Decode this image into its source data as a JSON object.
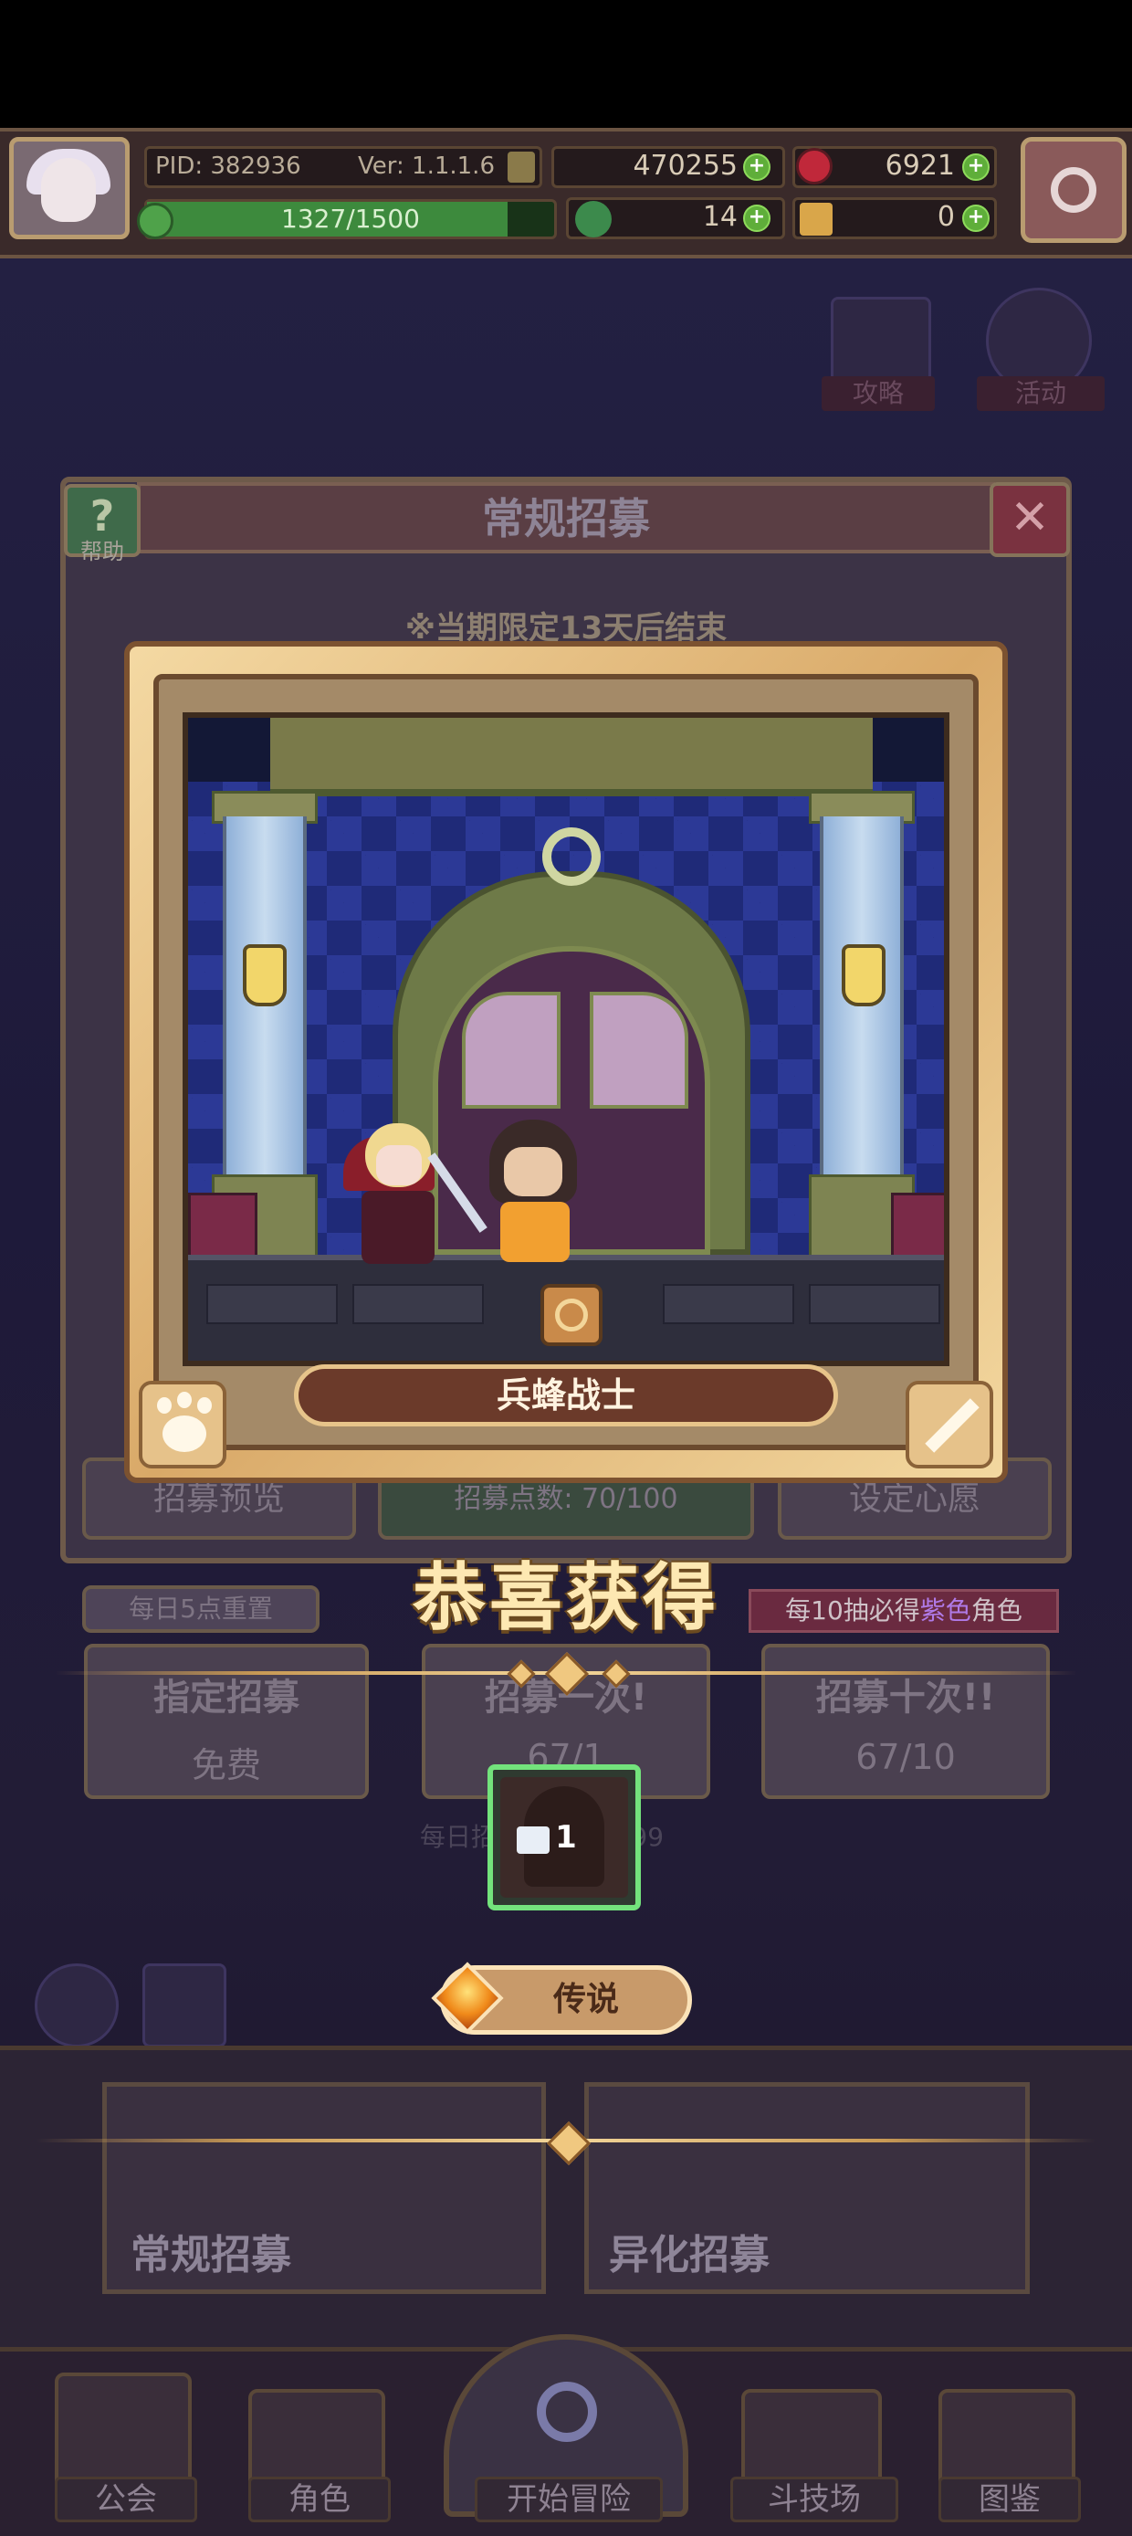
{
  "hud": {
    "pid": "PID: 382936",
    "version": "Ver: 1.1.1.6",
    "gold": "470255",
    "gems": "6921",
    "xp_text": "1327/1500",
    "xp_progress": 0.885,
    "clover": "14",
    "keys": "0"
  },
  "side_menu": {
    "guide_label": "攻略",
    "event_label": "活动"
  },
  "panel": {
    "title": "常规招募",
    "help_label": "帮助",
    "notice": "※当期限定13天后结束",
    "preview_label": "招募预览",
    "points_label": "招募点数: 70/100",
    "wish_label": "设定心愿",
    "daily_reset": "每日5点重置",
    "guarantee_prefix": "每10抽必得",
    "guarantee_color": "紫色",
    "guarantee_suffix": "角色",
    "single_title": "指定招募",
    "single_cost": "免费",
    "once_title": "招募一次!",
    "once_cost": "67/1",
    "ten_title": "招募十次!!",
    "ten_cost": "67/10",
    "daily_limit": "每日招募次数: /9999"
  },
  "reward": {
    "character_name": "兵蜂战士",
    "congrats": "恭喜获得",
    "item_count": "1",
    "rarity": "传说"
  },
  "bottom_tabs": {
    "normal": "常规招募",
    "mutation": "异化招募"
  },
  "nav": {
    "guild": "公会",
    "character": "角色",
    "adventure": "开始冒险",
    "arena": "斗技场",
    "codex": "图鉴"
  },
  "colors": {
    "legend_gem": "#f08a1a",
    "card_border": "#73e37c",
    "congrats_text": "#fde8b2",
    "purple_text": "#b07ae8"
  },
  "icons": [
    "gear-icon",
    "coin-icon",
    "gem-icon",
    "clover-icon",
    "key-icon",
    "close-icon",
    "help-icon",
    "paw-icon",
    "sword-icon",
    "magnifier-icon"
  ]
}
